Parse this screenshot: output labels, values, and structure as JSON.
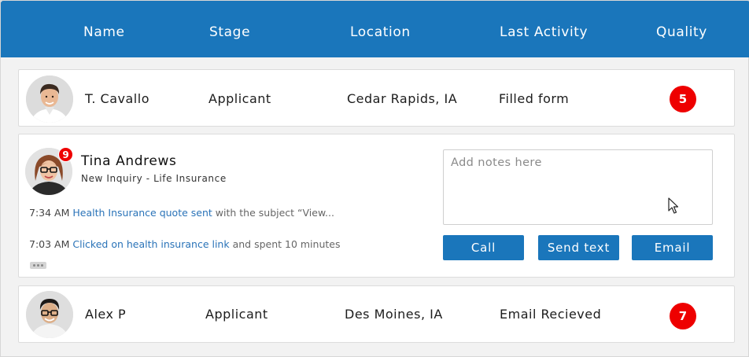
{
  "header": {
    "columns": [
      "Name",
      "Stage",
      "Location",
      "Last Activity",
      "Quality"
    ]
  },
  "rows": [
    {
      "name": "T. Cavallo",
      "stage": "Applicant",
      "location": "Cedar Rapids, IA",
      "last_activity": "Filled form",
      "quality": "5"
    },
    {
      "name": "Alex P",
      "stage": "Applicant",
      "location": "Des Moines, IA",
      "last_activity": "Email Recieved",
      "quality": "7"
    }
  ],
  "expanded": {
    "name": "Tina Andrews",
    "subtitle": "New Inquiry - Life Insurance",
    "notification_count": "9",
    "activities": [
      {
        "time": "7:34 AM",
        "link": "Health Insurance quote sent",
        "rest": "with the subject “View..."
      },
      {
        "time": "7:03 AM",
        "link": "Clicked on health insurance link",
        "rest": "and spent 10 minutes"
      }
    ],
    "notes": {
      "placeholder": "Add notes here",
      "value": ""
    },
    "buttons": {
      "call": "Call",
      "send_text": "Send text",
      "email": "Email"
    }
  },
  "icons": {
    "avatar": "person-avatar-icon",
    "more": "more-dots-icon",
    "cursor": "mouse-cursor-icon"
  },
  "colors": {
    "header_bg": "#1a76bb",
    "button_bg": "#1a76bb",
    "badge_bg": "#ee0000",
    "link": "#2a73b8"
  }
}
